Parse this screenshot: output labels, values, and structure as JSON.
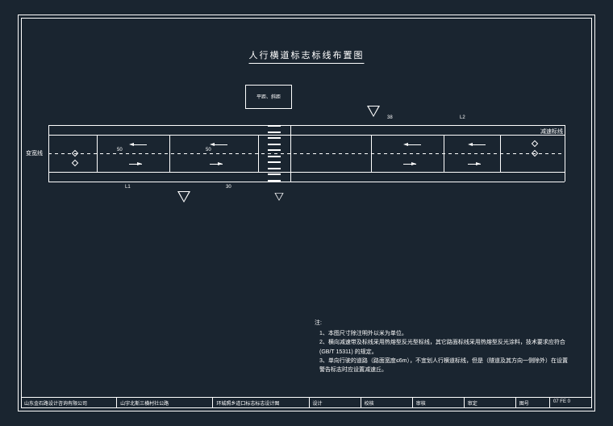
{
  "title": "人行横道标志标线布置图",
  "ped_box": "平距、斜距",
  "side_labels": {
    "left": "变宽线",
    "right": "减速标线"
  },
  "dims": {
    "l1": "L1",
    "l2": "L2",
    "d30": "30",
    "d38": "38",
    "d50": "50"
  },
  "notes": {
    "heading": "注:",
    "items": [
      "1、本图尺寸除注明外以米为单位。",
      "2、横向减速带及标线采用热熔型反光型标线，其它路面标线采用热熔型反光涂料，技术要求应符合 (GB/T 15311) 的规定。",
      "3、单向行驶的道路（路面宽度≤6m），不宜划人行横道标线，但是（隧道及其方向一侧除外）在设置警告标志时应设置减速丘。"
    ]
  },
  "titleblock": {
    "company": "山东金石路设计咨询有限公司",
    "project": "山宇北斯三横村社公路",
    "drawing": "环城照乡道口标志标志设计图",
    "design": "设计",
    "check": "校核",
    "review": "审核",
    "approve": "审定",
    "sheet_label": "图号",
    "sheet": "07 FE 0"
  }
}
